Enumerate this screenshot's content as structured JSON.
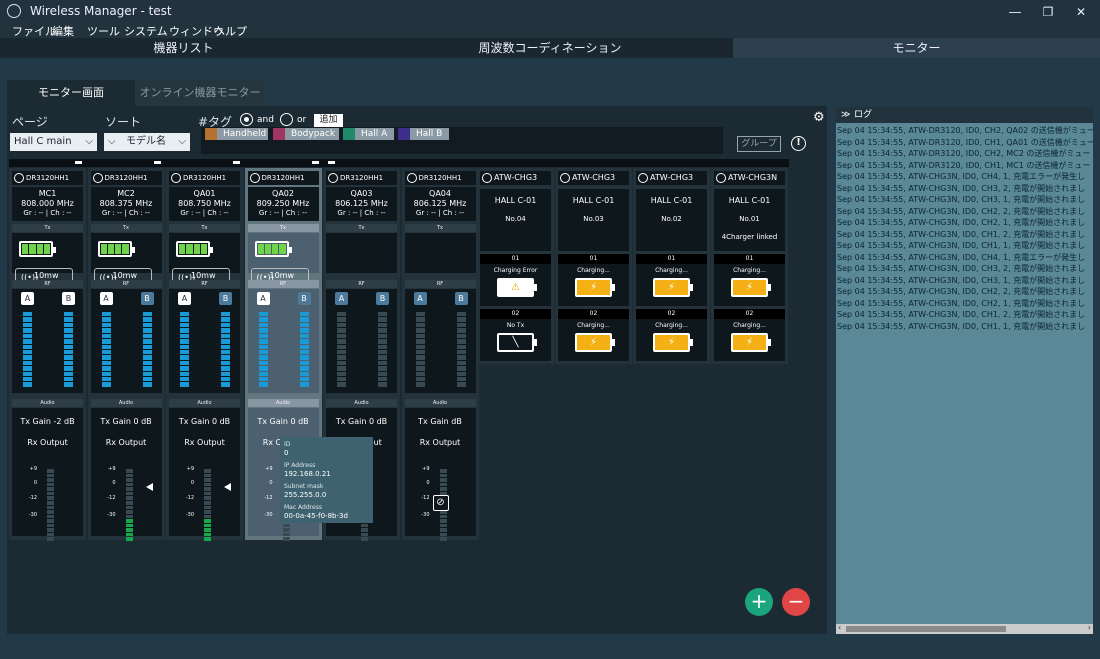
{
  "window": {
    "title": "Wireless Manager - test",
    "minimize": "―",
    "maximize": "❐",
    "close": "✕"
  },
  "menu": [
    "ファイル",
    "編集",
    "ツール",
    "システム",
    "ウィンドウ",
    "ヘルプ"
  ],
  "main_tabs": [
    "機器リスト",
    "周波数コーディネーション",
    "モニター"
  ],
  "sub_tabs": [
    "モニター画面",
    "オンライン機器モニター"
  ],
  "controls": {
    "page_label": "ページ",
    "page_value": "Hall C main",
    "sort_label": "ソート",
    "sort_value": "モデル名",
    "tag_label": "#タグ",
    "and_label": "and",
    "or_label": "or",
    "add_label": "追加",
    "group_label": "グループ",
    "info": "!"
  },
  "tags": [
    {
      "label": "Handheld",
      "color": "#b5712f"
    },
    {
      "label": "Bodypack",
      "color": "#a03463"
    },
    {
      "label": "Hall A",
      "color": "#1f8a6a"
    },
    {
      "label": "Hall B",
      "color": "#3c2e8c"
    }
  ],
  "labels": {
    "tx": "Tx",
    "rf": "RF",
    "audio": "Audio",
    "a": "A",
    "b": "B",
    "tx_gain": "Tx Gain",
    "db": "dB",
    "rx_output": "Rx Output",
    "rf_power": "10mw",
    "scale": [
      "+9",
      "0",
      "-12",
      "-30"
    ],
    "slot1": "01",
    "slot2": "02",
    "rf_icon": "((•))"
  },
  "receivers": [
    {
      "model": "DR3120HH1",
      "name": "MC1",
      "freq": "808.000 MHz",
      "gr": "Gr : -- | Ch : --",
      "gain": "-2",
      "a_white": true,
      "b_white": true,
      "meters_on": true,
      "level": 0,
      "marker": false
    },
    {
      "model": "DR3120HH1",
      "name": "MC2",
      "freq": "808.375 MHz",
      "gr": "Gr : -- | Ch : --",
      "gain": "0",
      "a_white": true,
      "b_white": false,
      "meters_on": true,
      "level": 0.33,
      "marker": true
    },
    {
      "model": "DR3120HH1",
      "name": "QA01",
      "freq": "808.750 MHz",
      "gr": "Gr : -- | Ch : --",
      "gain": "0",
      "a_white": true,
      "b_white": false,
      "meters_on": true,
      "level": 0.33,
      "marker": true
    },
    {
      "model": "DR3120HH1",
      "name": "QA02",
      "freq": "809.250 MHz",
      "gr": "Gr : -- | Ch : --",
      "gain": "0",
      "a_white": true,
      "b_white": false,
      "meters_on": true,
      "level": 0,
      "marker": false
    },
    {
      "model": "DR3120HH1",
      "name": "QA03",
      "freq": "806.125 MHz",
      "gr": "Gr : -- | Ch : --",
      "gain": "0",
      "a_white": false,
      "b_white": false,
      "meters_on": false,
      "level": 0,
      "marker": false
    },
    {
      "model": "DR3120HH1",
      "name": "QA04",
      "freq": "806.125 MHz",
      "gr": "Gr : -- | Ch : --",
      "gain": "",
      "a_white": false,
      "b_white": false,
      "meters_on": false,
      "level": 0,
      "marker": false
    }
  ],
  "chargers": [
    {
      "model": "ATW-CHG3",
      "loc": "HALL C-01",
      "no": "No.04",
      "extra": "",
      "s1": "Charging Error",
      "s2": "No Tx"
    },
    {
      "model": "ATW-CHG3",
      "loc": "HALL C-01",
      "no": "No.03",
      "extra": "",
      "s1": "Charging...",
      "s2": "Charging..."
    },
    {
      "model": "ATW-CHG3",
      "loc": "HALL C-01",
      "no": "No.02",
      "extra": "",
      "s1": "Charging...",
      "s2": "Charging..."
    },
    {
      "model": "ATW-CHG3N",
      "loc": "HALL C-01",
      "no": "No.01",
      "extra": "4Charger linked",
      "s1": "Charging...",
      "s2": "Charging..."
    }
  ],
  "tooltip": {
    "id_k": "ID",
    "id_v": "0",
    "ip_k": "IP Address",
    "ip_v": "192.168.0.21",
    "mask_k": "Subnet mask",
    "mask_v": "255.255.0.0",
    "mac_k": "Mac Address",
    "mac_v": "00-0a-45-f0-8b-3d"
  },
  "fab": {
    "add": "+",
    "remove": "−"
  },
  "log": {
    "title": "ログ",
    "lines": [
      "Sep 04 15:34:55, ATW-DR3120, ID0, CH2, QA02 の送信機がミュー",
      "Sep 04 15:34:55, ATW-DR3120, ID0, CH1, QA01 の送信機がミュー",
      "Sep 04 15:34:55, ATW-DR3120, ID0, CH2, MC2 の送信機がミュー",
      "Sep 04 15:34:55, ATW-DR3120, ID0, CH1, MC1 の送信機がミュー",
      "Sep 04 15:34:55, ATW-CHG3N, ID0, CH4, 1, 充電エラーが発生し",
      "Sep 04 15:34:55, ATW-CHG3N, ID0, CH3, 2, 充電が開始されまし",
      "Sep 04 15:34:55, ATW-CHG3N, ID0, CH3, 1, 充電が開始されまし",
      "Sep 04 15:34:55, ATW-CHG3N, ID0, CH2, 2, 充電が開始されまし",
      "Sep 04 15:34:55, ATW-CHG3N, ID0, CH2, 1, 充電が開始されまし",
      "Sep 04 15:34:55, ATW-CHG3N, ID0, CH1, 2, 充電が開始されまし",
      "Sep 04 15:34:55, ATW-CHG3N, ID0, CH1, 1, 充電が開始されまし",
      "Sep 04 15:34:55, ATW-CHG3N, ID0, CH4, 1, 充電エラーが発生し",
      "Sep 04 15:34:55, ATW-CHG3N, ID0, CH3, 2, 充電が開始されまし",
      "Sep 04 15:34:55, ATW-CHG3N, ID0, CH3, 1, 充電が開始されまし",
      "Sep 04 15:34:55, ATW-CHG3N, ID0, CH2, 2, 充電が開始されまし",
      "Sep 04 15:34:55, ATW-CHG3N, ID0, CH2, 1, 充電が開始されまし",
      "Sep 04 15:34:55, ATW-CHG3N, ID0, CH1, 2, 充電が開始されまし",
      "Sep 04 15:34:55, ATW-CHG3N, ID0, CH1, 1, 充電が開始されまし"
    ]
  }
}
